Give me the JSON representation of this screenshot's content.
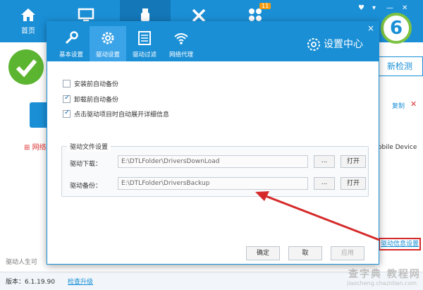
{
  "app": {
    "nav": [
      {
        "label": "首页",
        "icon": "home-icon"
      },
      {
        "label": "",
        "icon": "monitor-icon"
      },
      {
        "label": "",
        "icon": "usb-icon"
      },
      {
        "label": "",
        "icon": "tools-icon"
      },
      {
        "label": "",
        "icon": "apps-icon"
      }
    ],
    "badge": "11",
    "logo_text": "6",
    "redetect_label": "新检测",
    "copy_label": "复制",
    "mobile_device": "obile Device",
    "network_label": "网络",
    "driver_life_label": "驱动人生可",
    "version": "版本：6.1.19.90",
    "check_upgrade": "检查升级",
    "driver_info_settings": "驱动信息设置",
    "watermark_main": "查字典 教程网",
    "watermark_sub": "jiaocheng.chazidian.com"
  },
  "dialog": {
    "title": "设置中心",
    "close": "×",
    "tabs": [
      {
        "label": "基本设置",
        "icon": "wrench-icon"
      },
      {
        "label": "驱动设置",
        "icon": "gear-icon",
        "active": true
      },
      {
        "label": "驱动过滤",
        "icon": "list-icon"
      },
      {
        "label": "网络代理",
        "icon": "wifi-icon"
      }
    ],
    "options": [
      {
        "label": "安装前自动备份",
        "checked": false
      },
      {
        "label": "卸载前自动备份",
        "checked": true
      },
      {
        "label": "点击驱动项目时自动展开详细信息",
        "checked": true
      }
    ],
    "file_settings": {
      "title": "驱动文件设置",
      "download_label": "驱动下载：",
      "download_path": "E:\\DTLFolder\\DriversDownLoad",
      "backup_label": "驱动备份：",
      "backup_path": "E:\\DTLFolder\\DriversBackup",
      "browse_label": "...",
      "open_label": "打开"
    },
    "ok_label": "确定",
    "cancel_label": "取",
    "apply_label": "应用"
  },
  "colors": {
    "primary": "#1a8fd6",
    "tab_active": "#3ba3e8",
    "arrow": "#d62a2a",
    "success": "#5cb531"
  }
}
